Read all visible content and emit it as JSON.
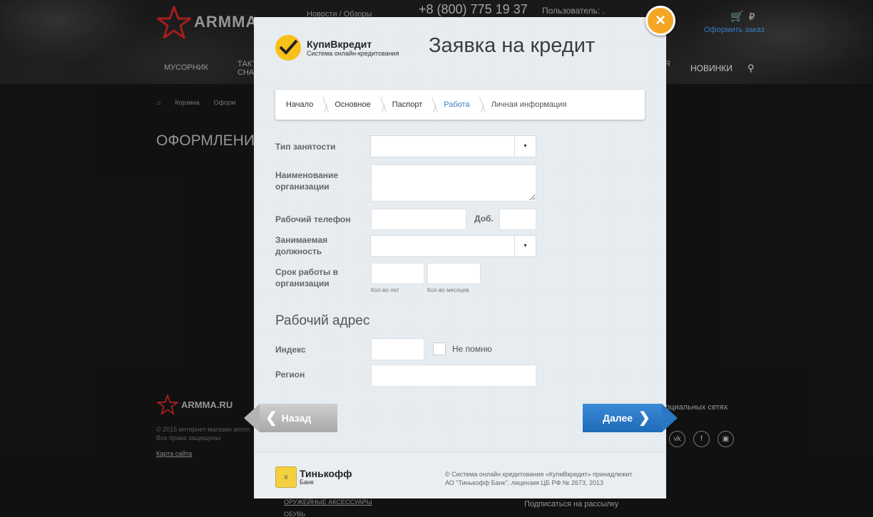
{
  "background_site": {
    "logo_text": "ARMMA.",
    "nav_news": "Новости / Обзоры",
    "phone": "+8 (800) 775 19 37",
    "user_label": "Пользователь: .",
    "cart_currency": "₽",
    "order_link": "Оформить заказ",
    "nav_item_1": "МУСОРНИК",
    "nav_item_2": "ТАКТ\nСНАР",
    "nav_item_r": "R",
    "nav_item_new": "НОВИНКИ",
    "breadcrumb_cart": "Корзина",
    "breadcrumb_order": "Оформ",
    "page_title": "ОФОРМЛЕНИ",
    "footer_logo_text": "ARMMA.RU",
    "copyright_1": "© 2015 интернет-магазин armm",
    "copyright_2": "Все права защищены",
    "sitemap": "Карта сайта",
    "accessories": "ОРУЖЕЙНЫЕ АКСЕССУАРЫ",
    "shoes": "ОБУВЬ",
    "social_title": "оциальных сетях",
    "socials": [
      "vk",
      "f",
      "ig"
    ],
    "subscribe": "Подписаться на рассылку"
  },
  "modal": {
    "brand_name": "КупиВкредит",
    "brand_sub": "Система онлайн-кредитования",
    "title": "Заявка на кредит",
    "steps": [
      {
        "label": "Начало",
        "state": "done"
      },
      {
        "label": "Основное",
        "state": "done"
      },
      {
        "label": "Паспорт",
        "state": "done"
      },
      {
        "label": "Работа",
        "state": "active"
      },
      {
        "label": "Личная информация",
        "state": "future"
      }
    ],
    "fields": {
      "employment_type_label": "Тип занятости",
      "org_name_label": "Наименование организации",
      "work_phone_label": "Рабочий телефон",
      "ext_label": "Доб.",
      "position_label": "Занимаемая должность",
      "work_period_label": "Срок работы в организации",
      "years_hint": "Кол-во лет",
      "months_hint": "Кол-во месяцев"
    },
    "address_section": {
      "title": "Рабочий адрес",
      "index_label": "Индекс",
      "dont_remember_label": "Не помню",
      "region_label": "Регион"
    },
    "back_button": "Назад",
    "next_button": "Далее",
    "footer_bank_name": "Тинькофф",
    "footer_bank_sub": "Банк",
    "footer_text_1": "© Система онлайн кредитования «КупиВкредит» принадлежит",
    "footer_text_2": "АО \"Тинькофф Банк\", лицензия ЦБ РФ № 2673, 2013",
    "close_icon": "×"
  },
  "colors": {
    "accent_blue": "#3b7fc4",
    "close_orange": "#f5a623",
    "brand_yellow": "#f8c11a"
  }
}
